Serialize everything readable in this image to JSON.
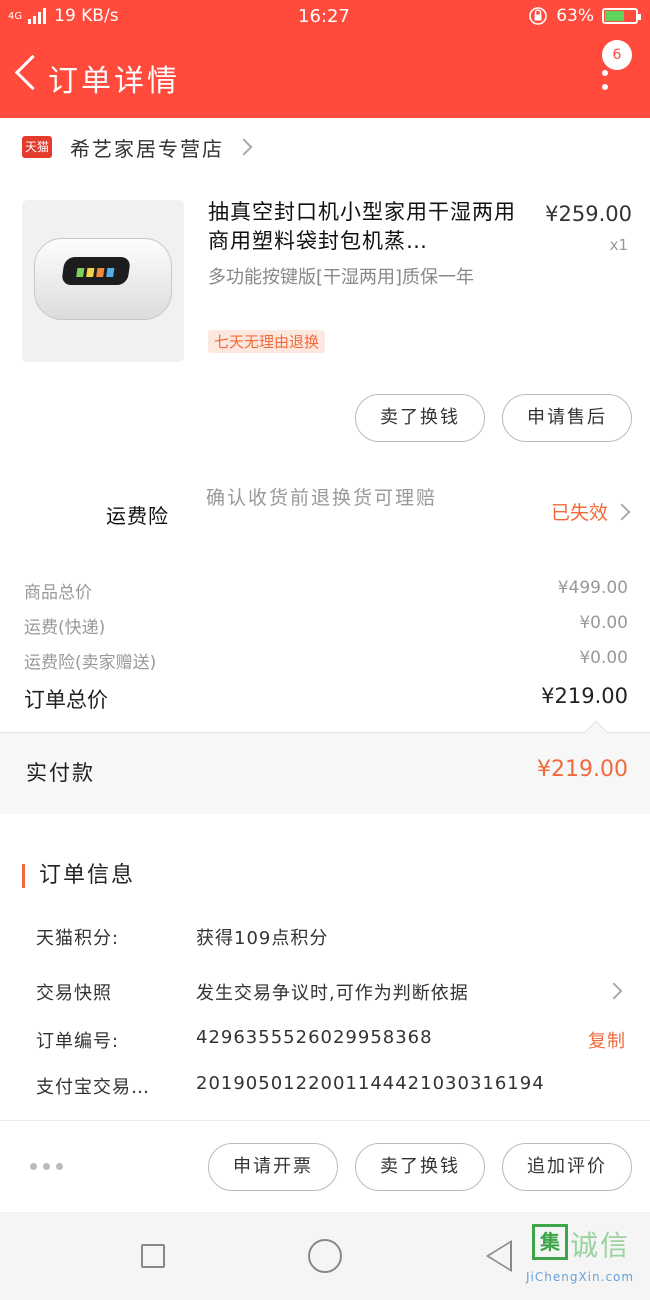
{
  "status_bar": {
    "network": "4G",
    "speed": "19 KB/s",
    "time": "16:27",
    "battery": "63%"
  },
  "header": {
    "title": "订单详情",
    "badge_count": "6"
  },
  "store": {
    "badge": "天猫",
    "name": "希艺家居专营店"
  },
  "product": {
    "name": "抽真空封口机小型家用干湿两用商用塑料袋封包机蒸…",
    "price": "¥259.00",
    "quantity": "x1",
    "spec": "多功能按键版[干湿两用]质保一年",
    "tag": "七天无理由退换"
  },
  "item_actions": {
    "sold_cash": "卖了换钱",
    "after_sale": "申请售后"
  },
  "insurance": {
    "label": "运费险",
    "desc": "确认收货前退换货可理赔",
    "status": "已失效"
  },
  "summary": {
    "goods_label": "商品总价",
    "goods_value": "¥499.00",
    "shipping_label": "运费(快递)",
    "shipping_value": "¥0.00",
    "insurance_label": "运费险(卖家赠送)",
    "insurance_value": "¥0.00",
    "total_label": "订单总价",
    "total_value": "¥219.00"
  },
  "payment": {
    "label": "实付款",
    "value": "¥219.00"
  },
  "order_info": {
    "title": "订单信息",
    "points_label": "天猫积分:",
    "points_value": "获得109点积分",
    "snapshot_label": "交易快照",
    "snapshot_value": "发生交易争议时,可作为判断依据",
    "order_no_label": "订单编号:",
    "order_no_value": "4296355526029958368",
    "copy": "复制",
    "alipay_label": "支付宝交易…",
    "alipay_value": "2019050122001144421030316194"
  },
  "bottom_actions": {
    "invoice": "申请开票",
    "sold_cash": "卖了换钱",
    "add_review": "追加评价"
  },
  "watermark": {
    "char": "集",
    "text": "诚信",
    "site": "JiChengXin.com"
  },
  "colors": {
    "header_red": "#ff4a3c",
    "accent_orange": "#f26a3b"
  }
}
